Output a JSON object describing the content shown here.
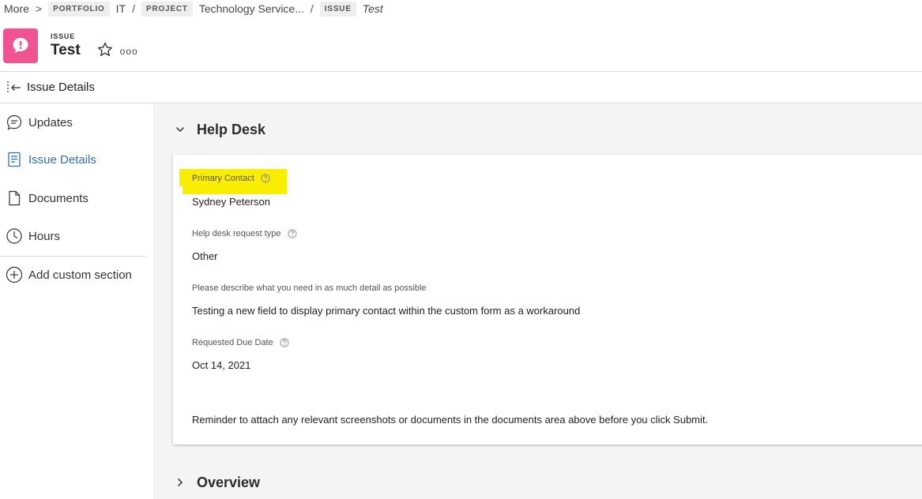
{
  "breadcrumb": {
    "more": "More",
    "more_sep": ">",
    "portfolio_tag": "PORTFOLIO",
    "portfolio_name": "IT",
    "sep": "/",
    "project_tag": "PROJECT",
    "project_name": "Technology Service...",
    "issue_tag": "ISSUE",
    "issue_name": "Test"
  },
  "header": {
    "object_type": "ISSUE",
    "title": "Test",
    "more_label": "ooo",
    "icon": "issue-exclamation-icon",
    "icon_color": "#f05391"
  },
  "section_bar": {
    "label": "Issue Details"
  },
  "sidebar": {
    "items": [
      {
        "label": "Updates",
        "icon": "updates-icon"
      },
      {
        "label": "Issue Details",
        "icon": "details-icon",
        "active": true
      },
      {
        "label": "Documents",
        "icon": "document-icon"
      },
      {
        "label": "Hours",
        "icon": "clock-icon"
      },
      {
        "label": "Add custom section",
        "icon": "plus-circle-icon"
      }
    ],
    "active_color": "#2f6fb5"
  },
  "main": {
    "help_desk_title": "Help Desk",
    "overview_title": "Overview",
    "fields": [
      {
        "label": "Primary Contact",
        "value": "Sydney Peterson",
        "highlighted": true
      },
      {
        "label": "Help desk request type",
        "value": "Other"
      },
      {
        "label": "Please describe what you need in as much detail as possible",
        "value": "Testing a new field to display primary contact within the custom form as a workaround"
      },
      {
        "label": "Requested Due Date",
        "value": "Oct 14, 2021"
      }
    ],
    "reminder": "Reminder to attach any relevant screenshots or documents in the documents area above before you click Submit.",
    "highlight_color": "#f9ee00"
  }
}
